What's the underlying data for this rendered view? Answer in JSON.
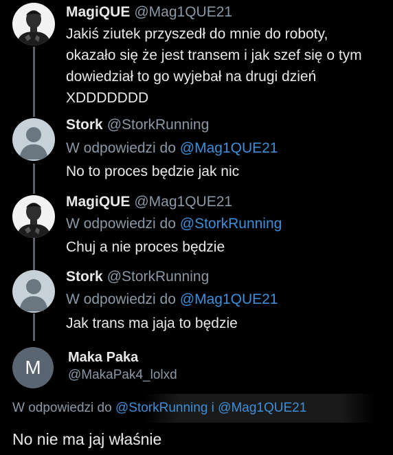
{
  "tweets": [
    {
      "name": "MagiQUE",
      "handle": "@Mag1QUE21",
      "avatar_icon": "player-photo-avatar",
      "text_lines": [
        "Jakiś ziutek przyszedł do mnie do roboty,",
        "okazało się że jest transem i jak szef się o tym",
        "dowiedział to go wyjebał na drugi dzień",
        "XDDDDDDD"
      ]
    },
    {
      "name": "Stork",
      "handle": "@StorkRunning",
      "avatar_icon": "default-user-avatar",
      "reply_prefix": "W odpowiedzi do",
      "reply_mention": "@Mag1QUE21",
      "text": "No to proces będzie jak nic"
    },
    {
      "name": "MagiQUE",
      "handle": "@Mag1QUE21",
      "avatar_icon": "player-photo-avatar",
      "reply_prefix": "W odpowiedzi do",
      "reply_mention": "@StorkRunning",
      "text": "Chuj a nie proces będzie"
    },
    {
      "name": "Stork",
      "handle": "@StorkRunning",
      "avatar_icon": "default-user-avatar",
      "reply_prefix": "W odpowiedzi do",
      "reply_mention": "@Mag1QUE21",
      "text": "Jak trans ma jaja to będzie"
    }
  ],
  "last": {
    "avatar_letter": "M",
    "name": "Maka Paka",
    "handle": "@MakaPak4_lolxd",
    "reply_prefix": "W odpowiedzi do",
    "reply_mention": "@StorkRunning i @Mag1QUE21",
    "text": "No nie ma jaj właśnie"
  },
  "colors": {
    "background": "#000000",
    "text": "#e7e9ea",
    "muted": "#8b98a5",
    "mention": "#3d8fd9",
    "thread_line": "#5b6166"
  }
}
